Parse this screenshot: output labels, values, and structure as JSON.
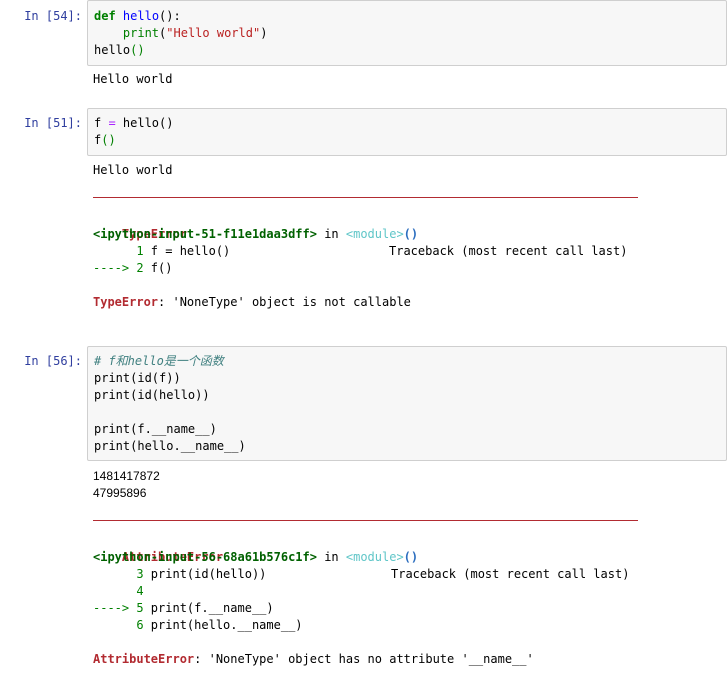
{
  "cells": [
    {
      "prompt": "In  [54]:",
      "code": {
        "l1": {
          "kw": "def",
          "name": "hello",
          "rest": "():"
        },
        "l2": {
          "indent": "    ",
          "bi": "print",
          "open": "(",
          "str": "\"Hello world\"",
          "close": ")"
        },
        "l3": {
          "name": "hello",
          "parens": "()"
        }
      },
      "output": "Hello world"
    },
    {
      "prompt": "In  [51]:",
      "code": {
        "l1": {
          "a": "f ",
          "op": "=",
          "b": " hello()"
        },
        "l2": {
          "a": "f",
          "parens": "()"
        }
      },
      "output": "Hello world",
      "traceback": {
        "error_name": "TypeError",
        "header_right": "Traceback (most recent call last)",
        "location": "<ipython-input-51-f11e1daa3dff>",
        "in": " in ",
        "module": "<module>",
        "module_parens": "()",
        "frame_lines": [
          {
            "marker": "      1 ",
            "code": "f = hello()"
          },
          {
            "marker": "----> 2 ",
            "code": "f()"
          }
        ],
        "final_name": "TypeError",
        "final_msg": ": 'NoneType' object is not callable"
      }
    },
    {
      "prompt": "In  [56]:",
      "code": {
        "comment": "# f和hello是一个函数",
        "l2": "print(id(f))",
        "l3": "print(id(hello))",
        "l5": "print(f.__name__)",
        "l6": "print(hello.__name__)"
      },
      "output_lines": [
        "1481417872",
        "47995896"
      ],
      "traceback": {
        "error_name": "AttributeError",
        "header_right": "Traceback (most recent call last)",
        "location": "<ipython-input-56-68a61b576c1f>",
        "in": " in ",
        "module": "<module>",
        "module_parens": "()",
        "frame_lines": [
          {
            "marker": "      3 ",
            "code": "print(id(hello))"
          },
          {
            "marker": "      4 ",
            "code": ""
          },
          {
            "marker": "----> 5 ",
            "code": "print(f.__name__)"
          },
          {
            "marker": "      6 ",
            "code": "print(hello.__name__)"
          }
        ],
        "final_name": "AttributeError",
        "final_msg": ": 'NoneType' object has no attribute '__name__'"
      }
    }
  ],
  "colors": {
    "prompt": "#303f9f",
    "error": "#b22b31",
    "keyword": "#008000",
    "string": "#ba2121",
    "input_bg": "#f7f7f7"
  }
}
